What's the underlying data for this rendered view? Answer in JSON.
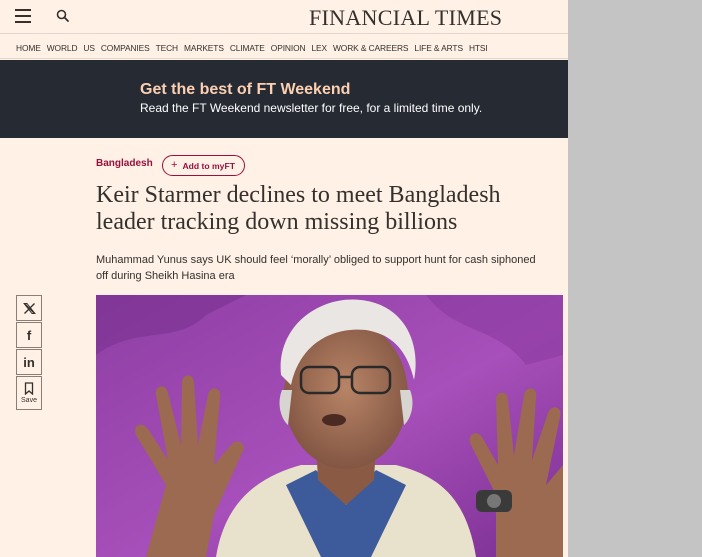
{
  "header": {
    "logo": "FINANCIAL TIMES",
    "menu_icon": "hamburger-menu-icon",
    "search_icon": "search-icon"
  },
  "nav": {
    "items": [
      "HOME",
      "WORLD",
      "US",
      "COMPANIES",
      "TECH",
      "MARKETS",
      "CLIMATE",
      "OPINION",
      "LEX",
      "WORK & CAREERS",
      "LIFE & ARTS",
      "HTSI"
    ]
  },
  "promo": {
    "title": "Get the best of FT Weekend",
    "text": "Read the FT Weekend newsletter for free, for a limited time only."
  },
  "article": {
    "topic": "Bangladesh",
    "add_myft": "Add to myFT",
    "headline": "Keir Starmer declines to meet Bangladesh leader tracking down missing billions",
    "standfirst": "Muhammad Yunus says UK should feel ‘morally’ obliged to support hunt for cash siphoned off during Sheikh Hasina era"
  },
  "share": {
    "x_glyph": "𝕏",
    "facebook_glyph": "f",
    "linkedin_glyph": "in",
    "save_label": "Save"
  },
  "colors": {
    "page_background": "#fff1e5",
    "promo_background": "#262a33",
    "promo_title": "#fcd0b1",
    "topic_accent": "#990f3d",
    "outer_background": "#c4c4c4"
  }
}
